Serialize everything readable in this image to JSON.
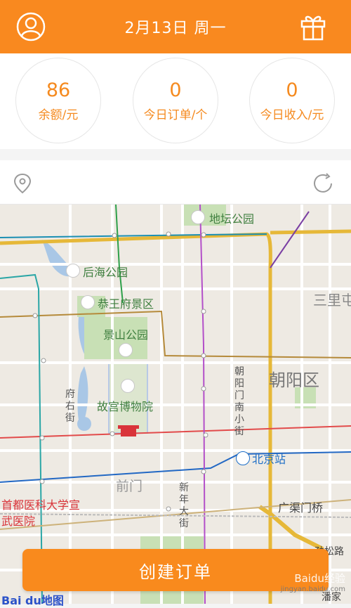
{
  "header": {
    "title": "2月13日  周一",
    "left_icon": "user-avatar-icon",
    "right_icon": "gift-icon"
  },
  "stats": [
    {
      "value": "86",
      "label": "余额/元"
    },
    {
      "value": "0",
      "label": "今日订单/个"
    },
    {
      "value": "0",
      "label": "今日收入/元"
    }
  ],
  "location_bar": {
    "left_icon": "location-pin-icon",
    "right_icon": "refresh-icon"
  },
  "map": {
    "labels": {
      "ditan_park": "地坛公园",
      "houhai_park": "后海公园",
      "gongwangfu": "恭王府景区",
      "jingshan_park": "景山公园",
      "palace_museum": "故宫博物院",
      "fuyoujie": "府右街",
      "chaoyangmen_south": "朝阳门南小街",
      "chaoyang_district": "朝阳区",
      "sanlitun": "三里屯",
      "beijing_station": "北京站",
      "qianmen": "前门",
      "xinnian_street": "新年大街",
      "hospital": "首都医科大学宣武医院",
      "guangqumen_bridge": "广渠门桥",
      "jinsongqiao": "劲松路",
      "panjiayuan": "潘家"
    }
  },
  "create_order_button": "创建订单",
  "map_logo": "Bai du地图",
  "watermark": {
    "main": "Baidu经验",
    "sub": "jingyan.baidu.com"
  },
  "colors": {
    "brand_orange": "#f9891f"
  }
}
